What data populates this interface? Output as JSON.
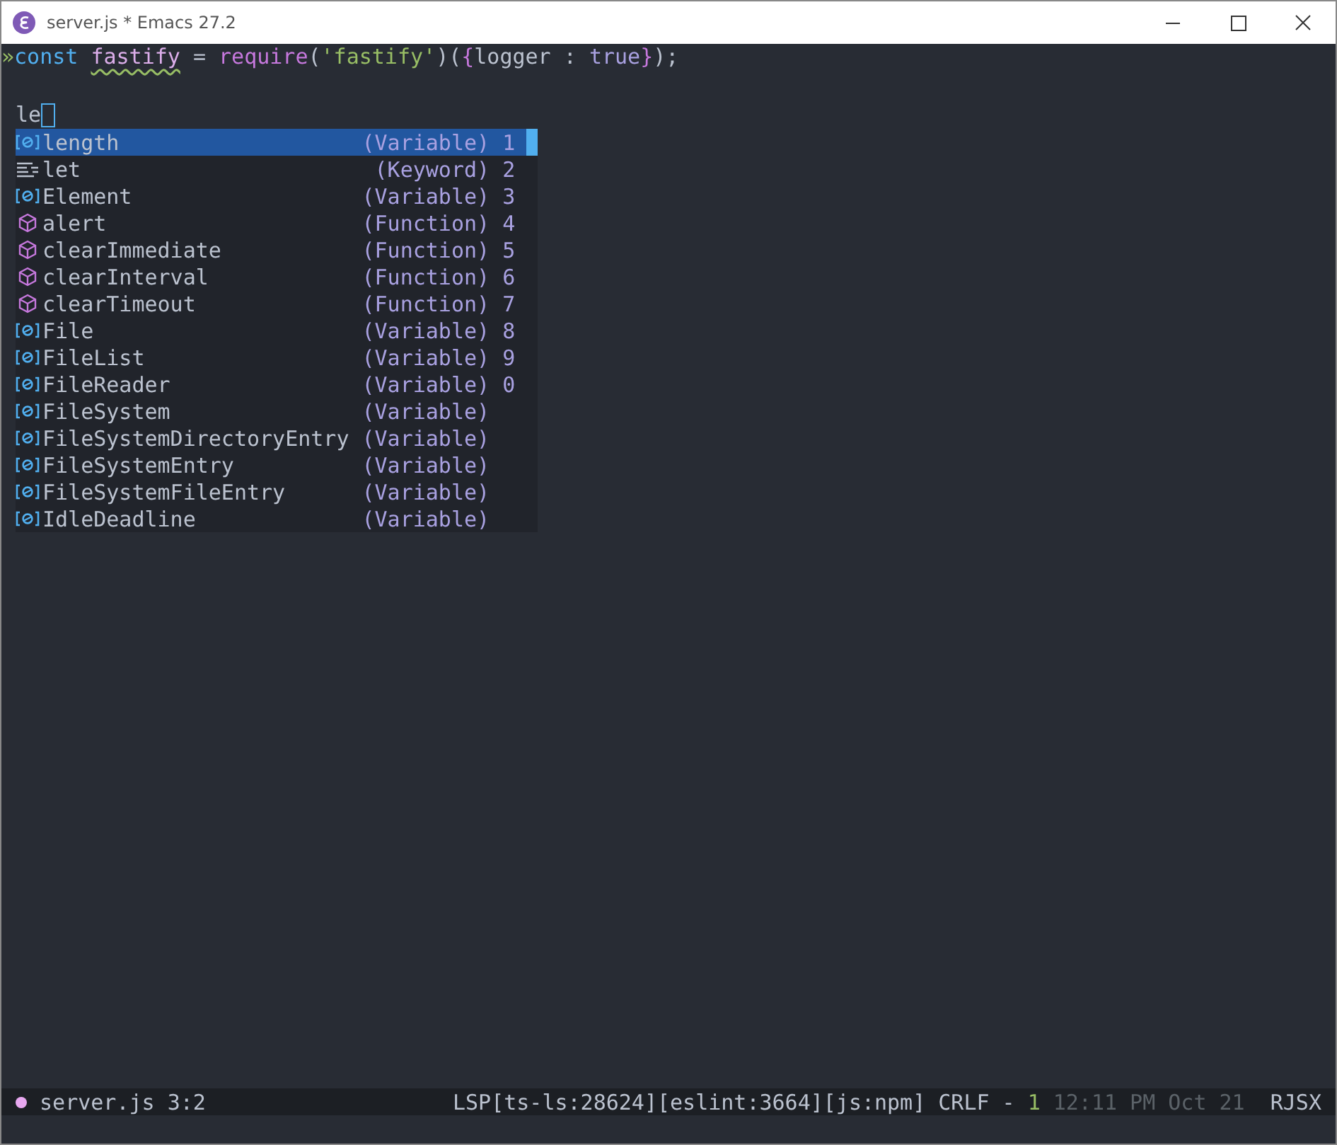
{
  "window": {
    "title": "server.js * Emacs 27.2"
  },
  "code_line": [
    {
      "text": "»",
      "kind": "fringe",
      "warning": false
    },
    {
      "text": "const ",
      "kind": "keyword",
      "warning": false
    },
    {
      "text": "fastify",
      "kind": "variable",
      "warning": true
    },
    {
      "text": " = ",
      "kind": "plain",
      "warning": false
    },
    {
      "text": "require",
      "kind": "function",
      "warning": false
    },
    {
      "text": "(",
      "kind": "plain",
      "warning": false
    },
    {
      "text": "'fastify'",
      "kind": "string",
      "warning": false
    },
    {
      "text": ")(",
      "kind": "plain",
      "warning": false
    },
    {
      "text": "{",
      "kind": "brace",
      "warning": false
    },
    {
      "text": "logger : ",
      "kind": "plain",
      "warning": false
    },
    {
      "text": "true",
      "kind": "constant",
      "warning": false
    },
    {
      "text": "}",
      "kind": "brace",
      "warning": false
    },
    {
      "text": ");",
      "kind": "plain",
      "warning": false
    }
  ],
  "input_line": "le",
  "completions": [
    {
      "label": "length",
      "type": "(Variable)",
      "key": "1",
      "kind": "variable",
      "selected": true
    },
    {
      "label": "let",
      "type": "(Keyword)",
      "key": "2",
      "kind": "keyword",
      "selected": false
    },
    {
      "label": "Element",
      "type": "(Variable)",
      "key": "3",
      "kind": "variable",
      "selected": false
    },
    {
      "label": "alert",
      "type": "(Function)",
      "key": "4",
      "kind": "function",
      "selected": false
    },
    {
      "label": "clearImmediate",
      "type": "(Function)",
      "key": "5",
      "kind": "function",
      "selected": false
    },
    {
      "label": "clearInterval",
      "type": "(Function)",
      "key": "6",
      "kind": "function",
      "selected": false
    },
    {
      "label": "clearTimeout",
      "type": "(Function)",
      "key": "7",
      "kind": "function",
      "selected": false
    },
    {
      "label": "File",
      "type": "(Variable)",
      "key": "8",
      "kind": "variable",
      "selected": false
    },
    {
      "label": "FileList",
      "type": "(Variable)",
      "key": "9",
      "kind": "variable",
      "selected": false
    },
    {
      "label": "FileReader",
      "type": "(Variable)",
      "key": "0",
      "kind": "variable",
      "selected": false
    },
    {
      "label": "FileSystem",
      "type": "(Variable)",
      "kind": "variable",
      "selected": false
    },
    {
      "label": "FileSystemDirectoryEntry",
      "type": "(Variable)",
      "kind": "variable",
      "selected": false
    },
    {
      "label": "FileSystemEntry",
      "type": "(Variable)",
      "kind": "variable",
      "selected": false
    },
    {
      "label": "FileSystemFileEntry",
      "type": "(Variable)",
      "kind": "variable",
      "selected": false
    },
    {
      "label": "IdleDeadline",
      "type": "(Variable)",
      "kind": "variable",
      "selected": false
    }
  ],
  "status_bar": {
    "indicator": {
      "color": "#e8a8f0"
    },
    "file": "server.js",
    "position": "3:2",
    "lsp": "LSP[ts-ls:28624][eslint:3664][js:npm]",
    "eol": "CRLF",
    "separator": "-",
    "errors": "1",
    "time": "12:11 PM Oct 21",
    "mode": "RJSX"
  }
}
